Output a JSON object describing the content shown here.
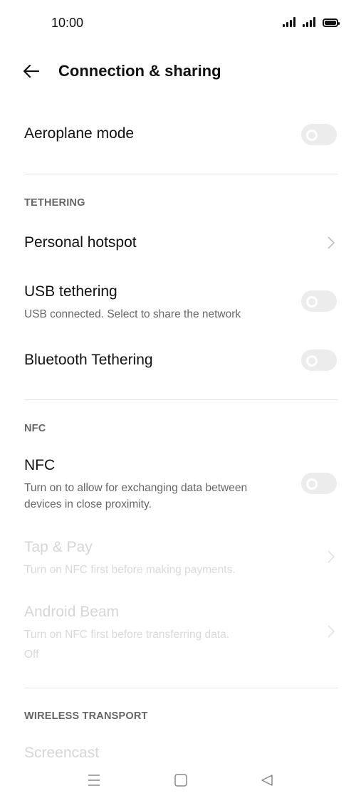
{
  "status": {
    "time": "10:00"
  },
  "header": {
    "title": "Connection & sharing"
  },
  "aeroplane": {
    "label": "Aeroplane mode"
  },
  "tethering": {
    "section": "TETHERING",
    "hotspot": "Personal hotspot",
    "usb": {
      "label": "USB tethering",
      "subtitle": "USB connected. Select to share the network"
    },
    "bluetooth": "Bluetooth Tethering"
  },
  "nfc": {
    "section": "NFC",
    "label": "NFC",
    "subtitle": "Turn on to allow for exchanging data between devices in close proximity.",
    "tap_pay": {
      "label": "Tap & Pay",
      "subtitle": "Turn on NFC first before making payments."
    },
    "android_beam": {
      "label": "Android Beam",
      "subtitle": "Turn on NFC first before transferring data.",
      "status": "Off"
    }
  },
  "wireless": {
    "section": "WIRELESS TRANSPORT",
    "screencast": "Screencast"
  },
  "icons": {
    "back": "back-arrow-icon",
    "chevron": "chevron-right-icon",
    "nav_menu": "menu-icon",
    "nav_home": "home-square-icon",
    "nav_back": "back-triangle-icon"
  },
  "toggles": {
    "aeroplane": false,
    "usb_tethering": false,
    "bluetooth_tethering": false,
    "nfc": false
  }
}
